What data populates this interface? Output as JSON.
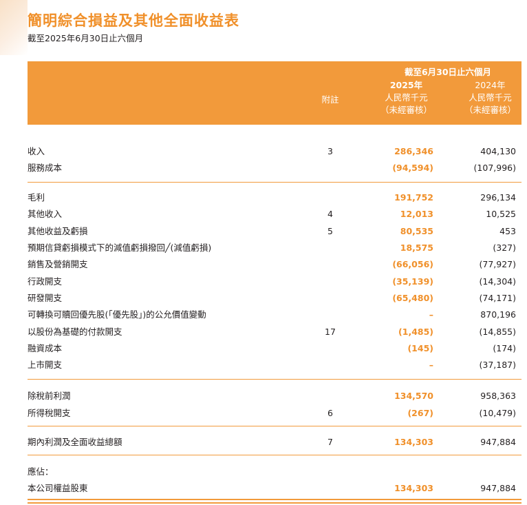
{
  "title": "簡明綜合損益及其他全面收益表",
  "subtitle": "截至2025年6月30日止六個月",
  "header": {
    "period": "截至6月30日止六個月",
    "note_label": "附註",
    "col1": {
      "year": "2025年",
      "unit": "人民幣千元",
      "audit": "（未經審核）"
    },
    "col2": {
      "year": "2024年",
      "unit": "人民幣千元",
      "audit": "（未經審核）"
    }
  },
  "rows": [
    {
      "label": "收入",
      "note": "3",
      "v2025": "286,346",
      "v2024": "404,130"
    },
    {
      "label": "服務成本",
      "note": "",
      "v2025": "(94,594)",
      "v2024": "(107,996)"
    },
    {
      "label": "毛利",
      "note": "",
      "v2025": "191,752",
      "v2024": "296,134"
    },
    {
      "label": "其他收入",
      "note": "4",
      "v2025": "12,013",
      "v2024": "10,525"
    },
    {
      "label": "其他收益及虧損",
      "note": "5",
      "v2025": "80,535",
      "v2024": "453"
    },
    {
      "label": "預期信貸虧損模式下的減值虧損撥回╱(減值虧損)",
      "note": "",
      "v2025": "18,575",
      "v2024": "(327)"
    },
    {
      "label": "銷售及營銷開支",
      "note": "",
      "v2025": "(66,056)",
      "v2024": "(77,927)"
    },
    {
      "label": "行政開支",
      "note": "",
      "v2025": "(35,139)",
      "v2024": "(14,304)"
    },
    {
      "label": "研發開支",
      "note": "",
      "v2025": "(65,480)",
      "v2024": "(74,171)"
    },
    {
      "label": "可轉換可贖回優先股(「優先股」)的公允價值變動",
      "note": "",
      "v2025": "–",
      "v2024": "870,196"
    },
    {
      "label": "以股份為基礎的付款開支",
      "note": "17",
      "v2025": "(1,485)",
      "v2024": "(14,855)"
    },
    {
      "label": "融資成本",
      "note": "",
      "v2025": "(145)",
      "v2024": "(174)"
    },
    {
      "label": "上市開支",
      "note": "",
      "v2025": "–",
      "v2024": "(37,187)"
    },
    {
      "label": "除稅前利潤",
      "note": "",
      "v2025": "134,570",
      "v2024": "958,363"
    },
    {
      "label": "所得稅開支",
      "note": "6",
      "v2025": "(267)",
      "v2024": "(10,479)"
    },
    {
      "label": "期內利潤及全面收益總額",
      "note": "7",
      "v2025": "134,303",
      "v2024": "947,884"
    },
    {
      "label": "應佔：",
      "note": "",
      "v2025": "",
      "v2024": ""
    },
    {
      "label": "本公司權益股東",
      "note": "",
      "v2025": "134,303",
      "v2024": "947,884"
    }
  ],
  "colors": {
    "accent": "#f29a3b",
    "accent_text": "#f0902a"
  }
}
